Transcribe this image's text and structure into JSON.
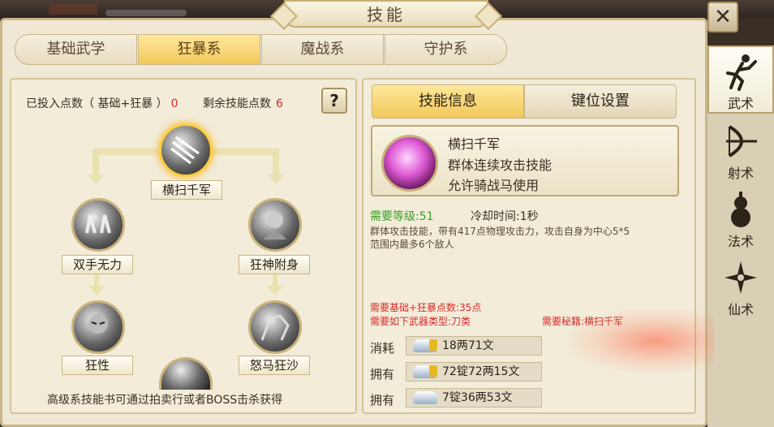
{
  "window": {
    "title": "技能",
    "close_label": "✕"
  },
  "tabs": [
    {
      "label": "基础武学",
      "active": false
    },
    {
      "label": "狂暴系",
      "active": true
    },
    {
      "label": "魔战系",
      "active": false
    },
    {
      "label": "守护系",
      "active": false
    }
  ],
  "sidebar": [
    {
      "label": "武术",
      "icon": "martial-arts-icon",
      "active": true
    },
    {
      "label": "射术",
      "icon": "archery-icon",
      "active": false
    },
    {
      "label": "法术",
      "icon": "magic-gourd-icon",
      "active": false
    },
    {
      "label": "仙术",
      "icon": "immortal-shuriken-icon",
      "active": false
    }
  ],
  "points": {
    "invested_label": "已投入点数（ 基础+狂暴 ）",
    "invested_value": "0",
    "remaining_label": "剩余技能点数",
    "remaining_value": "6",
    "help": "?"
  },
  "tree": {
    "nodes": [
      {
        "name": "横扫千军",
        "selected": true
      },
      {
        "name": "双手无力",
        "selected": false
      },
      {
        "name": "狂神附身",
        "selected": false
      },
      {
        "name": "狂性",
        "selected": false
      },
      {
        "name": "怒马狂沙",
        "selected": false
      }
    ],
    "footer": "高级系技能书可通过拍卖行或者BOSS击杀获得"
  },
  "info_tabs": [
    {
      "label": "技能信息",
      "active": true
    },
    {
      "label": "键位设置",
      "active": false
    }
  ],
  "skill": {
    "name": "横扫千军",
    "type": "群体连续攻击技能",
    "mount": "允许骑战马使用",
    "level_req": "需要等级:51",
    "cooldown": "冷却时间:1秒",
    "desc_line1": "群体攻击技能，带有417点物理攻击力，攻击自身为中心5*5",
    "desc_line2": "范围内最多6个敌人",
    "req_points": "需要基础+狂暴点数:35点",
    "req_weapon": "需要如下武器类型:刀类",
    "req_book": "需要秘籍:横扫千军"
  },
  "costs": [
    {
      "label": "消耗",
      "value": "18两71文",
      "locked": true
    },
    {
      "label": "拥有",
      "value": "72锭72两15文",
      "locked": true
    },
    {
      "label": "拥有",
      "value": "7锭36两53文",
      "locked": false
    }
  ],
  "colors": {
    "accent": "#f2c95c",
    "red": "#d82a2a",
    "green": "#3c9c2c",
    "panel": "#efe8d4"
  }
}
